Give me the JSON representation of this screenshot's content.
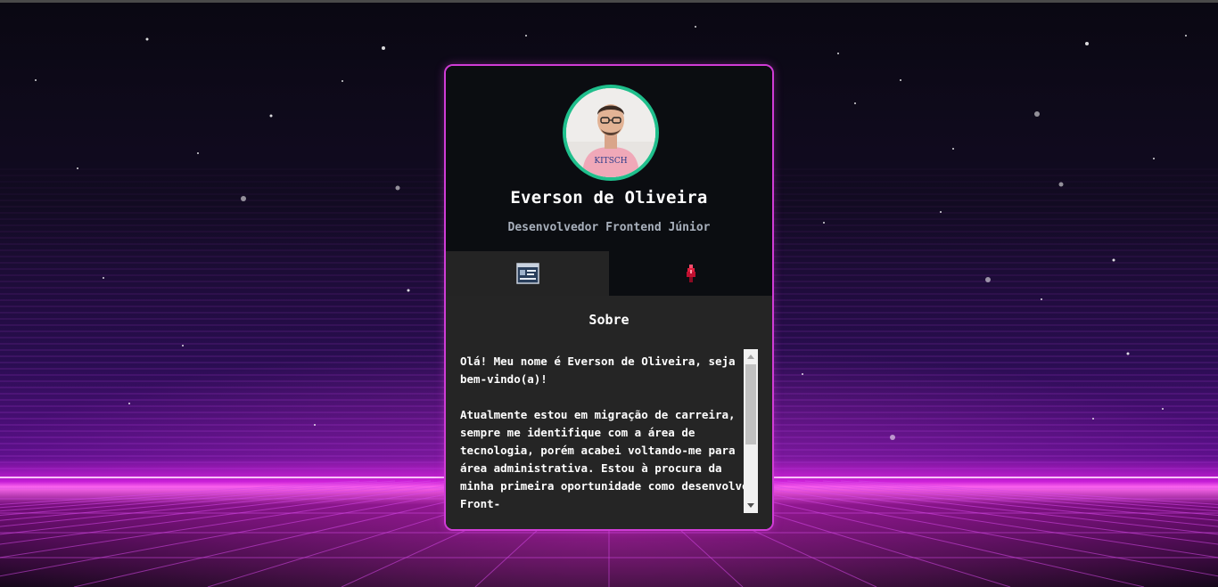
{
  "profile": {
    "name": "Everson de Oliveira",
    "role": "Desenvolvedor Frontend Júnior",
    "avatar_alt": "Everson de Oliveira",
    "avatar_shirt_text": "KITSCH"
  },
  "tabs": [
    {
      "id": "about",
      "icon": "profile-card-icon",
      "active": true
    },
    {
      "id": "skills",
      "icon": "flame-icon",
      "active": false
    }
  ],
  "about": {
    "title": "Sobre",
    "text": "Olá! Meu nome é Everson de Oliveira, seja bem-vindo(a)!\n\nAtualmente estou em migração de carreira, sempre me identifique com a área de tecnologia, porém acabei voltando-me para área administrativa. Estou à procura da minha primeira oportunidade como desenvolver Front-"
  },
  "colors": {
    "card_border": "#d03cd6",
    "avatar_ring": "#1fbf8c",
    "card_bg": "#0b0d11",
    "content_bg": "#252525",
    "grid_glow": "#ff3ce6"
  }
}
